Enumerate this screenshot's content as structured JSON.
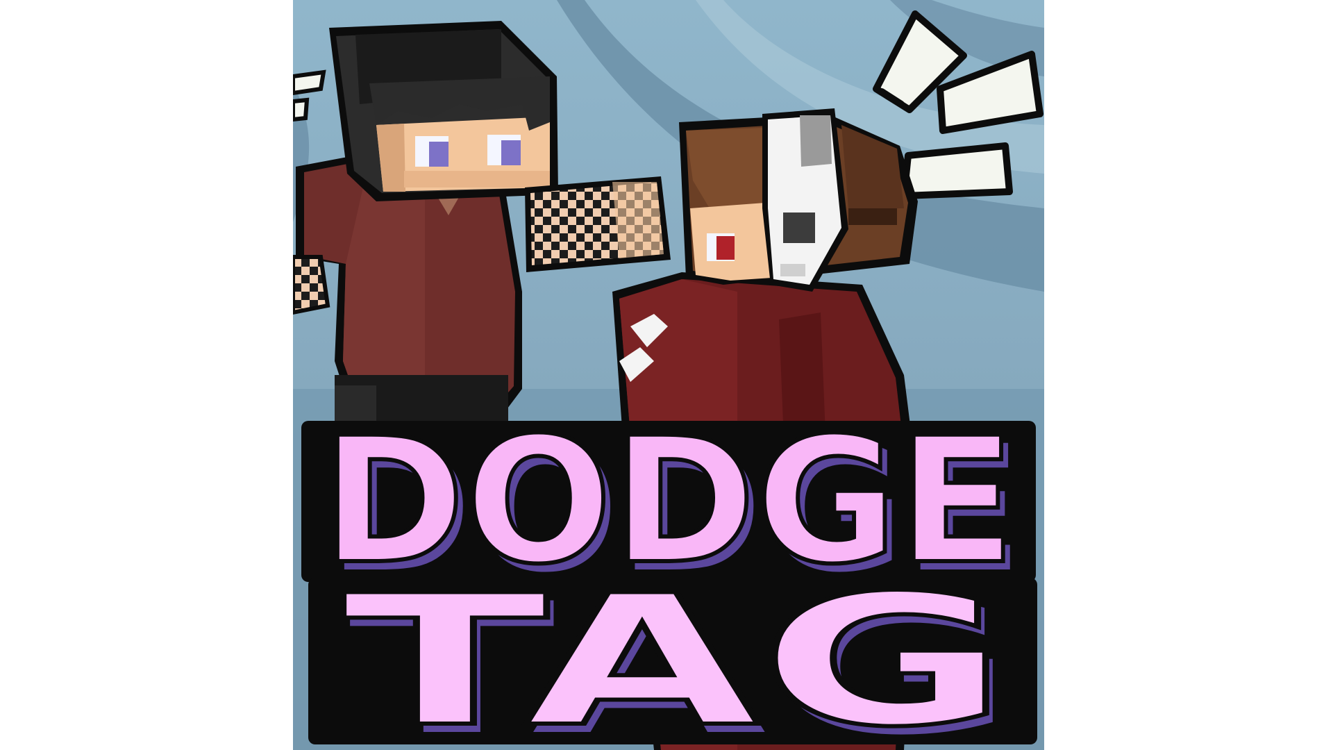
{
  "title": {
    "line1": "DODGE",
    "line2": "TAG"
  },
  "colors": {
    "background_light": "#8fb4c9",
    "background_dark": "#6a8da4",
    "title_fill": "#f7a8f5",
    "title_face": "#fbd2fb",
    "title_shadow": "#5b479d",
    "outline": "#0c0c0c",
    "hoodie": "#6f2e2b",
    "hoodie_dark": "#5b1a1a"
  },
  "characters": [
    {
      "name_icon": "dark-hair-character-icon"
    },
    {
      "name_icon": "masked-character-icon"
    }
  ],
  "effects": {
    "icon": "impact-burst-icon"
  }
}
